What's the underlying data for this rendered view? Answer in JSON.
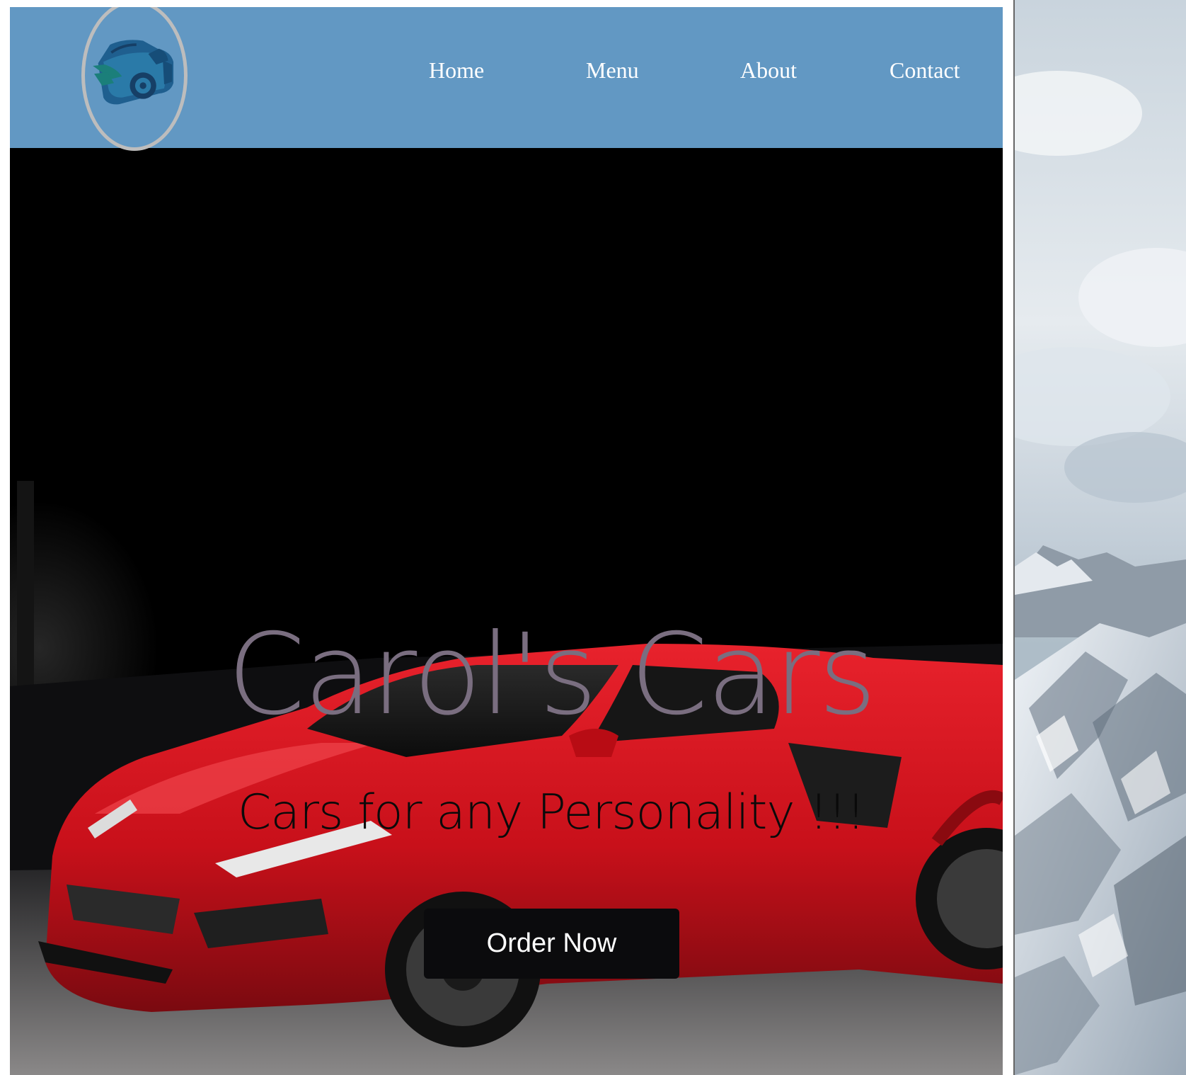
{
  "site": {
    "nav": {
      "home": "Home",
      "menu": "Menu",
      "about": "About",
      "contact": "Contact"
    },
    "logo_icon": "sports-car-logo-icon"
  },
  "hero": {
    "title": "Carol's Cars",
    "subtitle": "Cars for any Personality !!!",
    "cta_label": "Order Now",
    "image": "red-sports-car"
  },
  "background": {
    "image": "snowy-mountain"
  },
  "colors": {
    "header": "#6298c3",
    "logo_border": "#bdbdbd",
    "title": "#7a6e80",
    "button": "#0b0b0d",
    "car": "#c8101a"
  }
}
